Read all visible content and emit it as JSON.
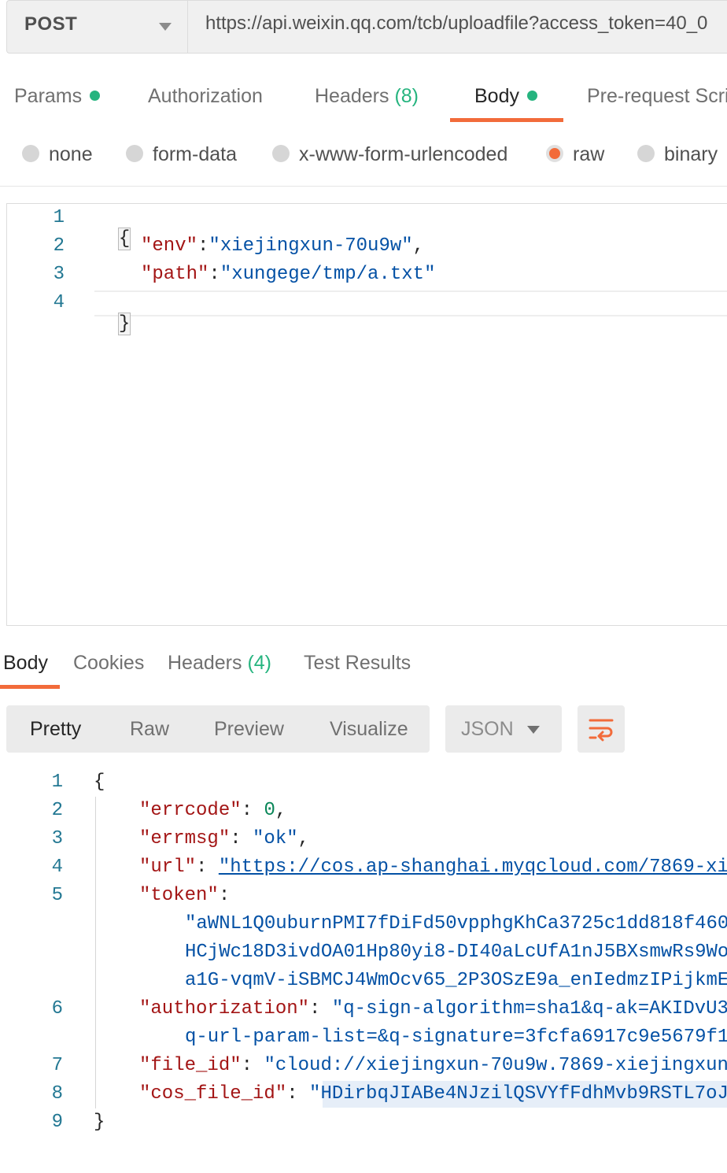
{
  "request": {
    "method": "POST",
    "url": "https://api.weixin.qq.com/tcb/uploadfile?access_token=40_0",
    "tabs": {
      "params": "Params",
      "authorization": "Authorization",
      "headers": "Headers",
      "headers_count": "(8)",
      "body": "Body",
      "prerequest": "Pre-request Scri"
    },
    "body_types": [
      "none",
      "form-data",
      "x-www-form-urlencoded",
      "raw",
      "binary"
    ],
    "selected_body_type": "raw",
    "editor": {
      "line_numbers": [
        "1",
        "2",
        "3",
        "4"
      ],
      "open_brace": "{",
      "close_brace": "}",
      "env_key": "\"env\"",
      "env_value": "\"xiejingxun-70u9w\"",
      "path_key": "\"path\"",
      "path_value": "\"xungege/tmp/a.txt\""
    }
  },
  "response": {
    "tabs": {
      "body": "Body",
      "cookies": "Cookies",
      "headers": "Headers",
      "headers_count": "(4)",
      "test_results": "Test Results"
    },
    "formats": {
      "pretty": "Pretty",
      "raw": "Raw",
      "preview": "Preview",
      "visualize": "Visualize"
    },
    "language": "JSON",
    "line_numbers": [
      "1",
      "2",
      "3",
      "4",
      "5",
      "6",
      "7",
      "8",
      "9"
    ],
    "body": {
      "open_brace": "{",
      "close_brace": "}",
      "errcode_key": "\"errcode\"",
      "errcode_value": "0",
      "errmsg_key": "\"errmsg\"",
      "errmsg_value": "\"ok\"",
      "url_key": "\"url\"",
      "url_value": "\"https://cos.ap-shanghai.myqcloud.com/7869-xi",
      "token_key": "\"token\"",
      "token_line1": "\"aWNL1Q0uburnPMI7fDiFd50vpphgKhCa3725c1dd818f460",
      "token_line2": "HCjWc18D3ivdOA01Hp80yi8-DI40aLcUfA1nJ5BXsmwRs9Wo",
      "token_line3": "a1G-vqmV-iSBMCJ4WmOcv65_2P3OSzE9a_enIedmzIPijkmE",
      "auth_key": "\"authorization\"",
      "auth_line1": "\"q-sign-algorithm=sha1&q-ak=AKIDvU3",
      "auth_line2": "q-url-param-list=&q-signature=3fcfa6917c9e5679f1",
      "file_id_key": "\"file_id\"",
      "file_id_value": "\"cloud://xiejingxun-70u9w.7869-xiejingxun",
      "cos_key": "\"cos_file_id\"",
      "cos_value": "\"HDirbqJIABe4NJzilQSVYfFdhMvb9RSTL7oJ"
    }
  },
  "colors": {
    "accent": "#f26b3a",
    "status_dot": "#26b47f",
    "json_key": "#a31515",
    "json_string": "#0451a5",
    "json_number": "#098658",
    "line_number": "#237893"
  }
}
